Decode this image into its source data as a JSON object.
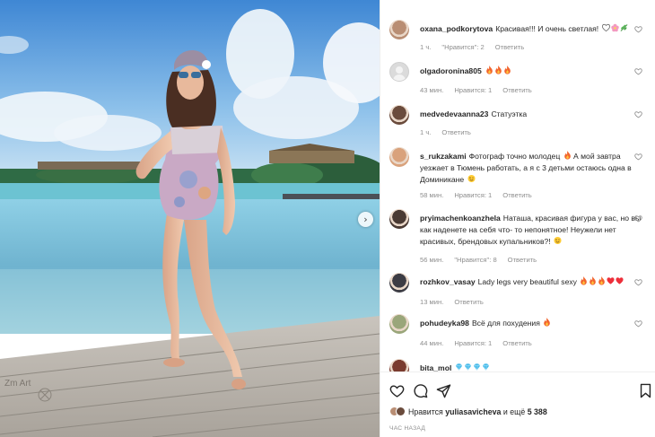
{
  "comments": [
    {
      "username": "oxana_podkorytova",
      "text": "Красивая!!! И очень светлая!",
      "emojis": [
        "🤍",
        "🌸",
        "🌿"
      ],
      "time": "1 ч.",
      "likes": "\"Нравится\": 2",
      "reply": "Ответить",
      "avatar_color": "#b98e74"
    },
    {
      "username": "olgadoronina805",
      "text": "",
      "emojis": [
        "🔥",
        "🔥",
        "🔥"
      ],
      "time": "43 мин.",
      "likes": "Нравится: 1",
      "reply": "Ответить",
      "avatar_color": ""
    },
    {
      "username": "medvedevaanna23",
      "text": "Статуэтка",
      "emojis": [],
      "time": "1 ч.",
      "likes": "",
      "reply": "Ответить",
      "avatar_color": "#6a4b3c"
    },
    {
      "username": "s_rukzakami",
      "text": "Фотограф точно молодец",
      "emojis": [
        "🔥"
      ],
      "text2": "А мой завтра уезжает в Тюмень работать, а я с 3 детьми остаюсь одна в Доминикане",
      "emojis2": [
        "😉"
      ],
      "time": "58 мин.",
      "likes": "Нравится: 1",
      "reply": "Ответить",
      "avatar_color": "#d9a27c"
    },
    {
      "username": "pryimachenkoanzhela",
      "text": "Наташа, красивая фигура у вас, но вы как наденете на себя что- то непонятное! Неужели нет красивых, брендовых купальников?!",
      "emojis": [
        "😉"
      ],
      "time": "56 мин.",
      "likes": "\"Нравится\": 8",
      "reply": "Ответить",
      "avatar_color": "#4a3a33"
    },
    {
      "username": "rozhkov_vasay",
      "text": "Lady legs very beautiful sexy",
      "emojis": [
        "🔥",
        "🔥",
        "🔥",
        "❤️",
        "❤️"
      ],
      "time": "13 мин.",
      "likes": "",
      "reply": "Ответить",
      "avatar_color": "#3c3c44"
    },
    {
      "username": "pohudeyka98",
      "text": "Всё для похудения",
      "emojis": [
        "🔥"
      ],
      "time": "44 мин.",
      "likes": "Нравится: 1",
      "reply": "Ответить",
      "avatar_color": "#9aa67a"
    },
    {
      "username": "bita_mol",
      "text": "",
      "emojis": [
        "💎",
        "💎",
        "💎",
        "💎"
      ],
      "time": "",
      "likes": "",
      "reply": "",
      "avatar_color": "#7a3b2f"
    }
  ],
  "actions": {
    "like": "heart-outline-icon",
    "comment": "comment-bubble-icon",
    "share": "paper-plane-icon",
    "save": "bookmark-icon"
  },
  "likes_line": {
    "prefix": "Нравится",
    "user": "yuliasavicheva",
    "middle": "и ещё",
    "count": "5 388"
  },
  "time_ago": "ЧАС НАЗАД",
  "photo": {
    "watermark": "Zm  Art",
    "nav": "›"
  },
  "colors": {
    "fire": "#f2652e",
    "heart": "#ed2f3a",
    "diamond": "#39b6e8",
    "muted": "#8e8e8e"
  }
}
